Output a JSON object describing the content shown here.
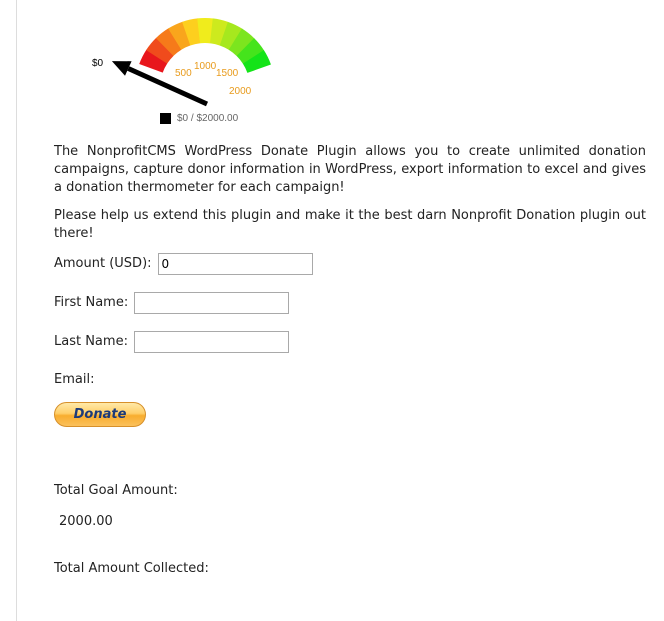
{
  "gauge": {
    "current_label": "$0",
    "ticks": [
      "500",
      "1000",
      "1500",
      "2000"
    ],
    "legend": "$0 / $2000.00",
    "value": 0,
    "max": 2000,
    "arc_colors": [
      "#e8161c",
      "#f04b1c",
      "#f67a1a",
      "#f9a51c",
      "#fdcf1e",
      "#f0ec1c",
      "#cdea1e",
      "#a6e81e",
      "#7ce51e",
      "#45e41c",
      "#14e418"
    ]
  },
  "description": {
    "paragraph1": "The NonprofitCMS WordPress Donate Plugin allows you to create unlimited donation campaigns, capture donor information in WordPress, export information to excel and gives a donation thermometer for each campaign!",
    "paragraph2": "Please help us extend this plugin and make it the best darn Nonprofit Donation plugin out there!"
  },
  "form": {
    "amount_label": "Amount (USD):",
    "amount_value": "0",
    "first_name_label": "First Name:",
    "first_name_value": "",
    "last_name_label": "Last Name:",
    "last_name_value": "",
    "email_label": "Email:",
    "donate_label": "Donate"
  },
  "totals": {
    "goal_label": "Total Goal Amount:",
    "goal_value": "2000.00",
    "collected_label": "Total Amount Collected:"
  }
}
